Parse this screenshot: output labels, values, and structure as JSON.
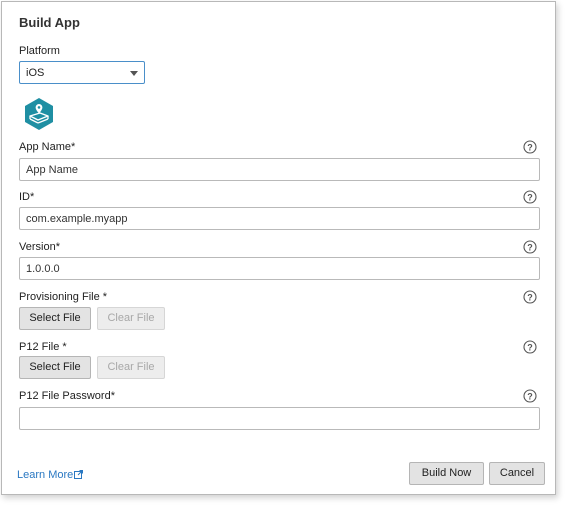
{
  "dialog": {
    "title": "Build App"
  },
  "platform": {
    "label": "Platform",
    "selected": "iOS"
  },
  "fields": {
    "app_name": {
      "label": "App Name*",
      "value": "App Name"
    },
    "id": {
      "label": "ID*",
      "value": "com.example.myapp"
    },
    "version": {
      "label": "Version*",
      "value": "1.0.0.0"
    },
    "provisioning_file": {
      "label": "Provisioning File *",
      "select_label": "Select File",
      "clear_label": "Clear File"
    },
    "p12_file": {
      "label": "P12 File *",
      "select_label": "Select File",
      "clear_label": "Clear File"
    },
    "p12_password": {
      "label": "P12 File Password*",
      "value": ""
    }
  },
  "footer": {
    "learn_more": "Learn More",
    "build_now": "Build Now",
    "cancel": "Cancel"
  },
  "icons": {
    "app_icon": "map-app-icon",
    "help": "question-circle-icon",
    "external_link": "external-link-icon",
    "dropdown": "chevron-down-icon"
  },
  "colors": {
    "accent_border": "#4a8fc9",
    "app_icon_bg": "#1f8fa3",
    "link": "#2a78c2"
  }
}
